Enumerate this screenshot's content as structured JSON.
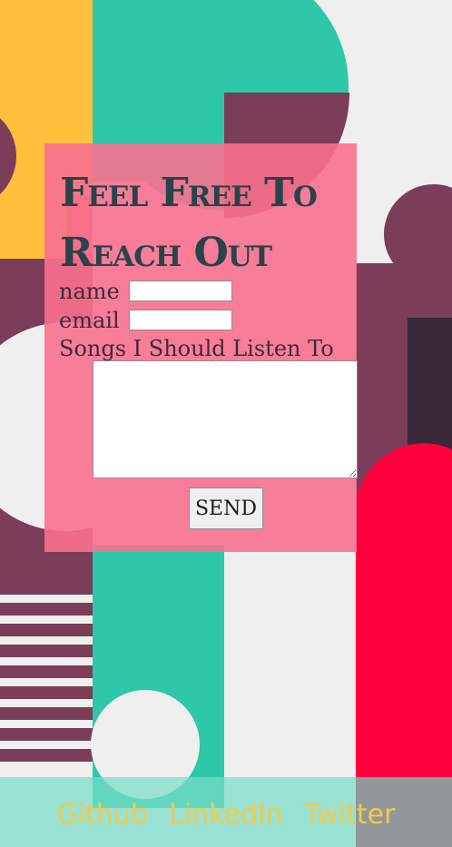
{
  "colors": {
    "yellow": "#ffc13c",
    "orange": "#ff6b3d",
    "teal": "#2ec7a8",
    "plum": "#7b3d58",
    "crimson": "#ff003d",
    "dark": "#3a2838",
    "card": "#f8708f",
    "footer": "#8ddecb",
    "link": "#f4c94a"
  },
  "contact": {
    "title_line1": "Feel Free To",
    "title_line2": "Reach Out",
    "name_label": "name",
    "name_value": "",
    "email_label": "email",
    "email_value": "",
    "songs_label": "Songs I Should Listen To",
    "songs_value": "",
    "send_label": "SEND"
  },
  "footer": {
    "links": [
      "Github",
      "LinkedIn",
      "Twitter"
    ]
  }
}
